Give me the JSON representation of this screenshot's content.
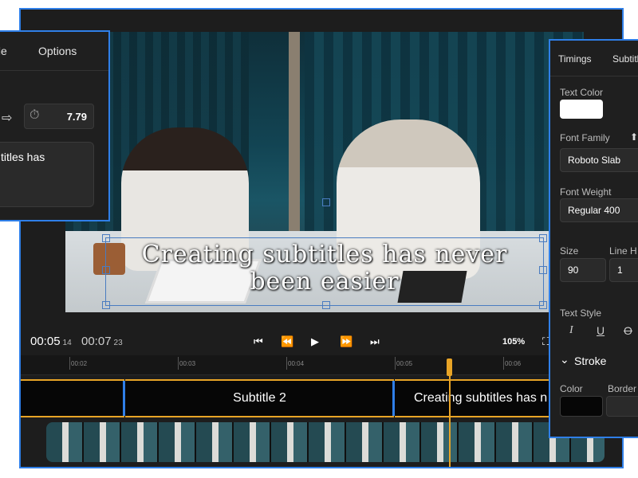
{
  "colors": {
    "accent": "#2f7fe8",
    "track": "#e8a426",
    "text_color_swatch": "#ffffff",
    "stroke_color_swatch": "#060606"
  },
  "video": {
    "caption_line1": "Creating subtitles has never",
    "caption_line2": "been easier"
  },
  "player": {
    "current_time": "00:05",
    "current_frames": "14",
    "total_time": "00:07",
    "total_frames": "23",
    "controls": {
      "skip_start": "⏮",
      "rewind": "⏪",
      "play": "▶",
      "forward": "⏩",
      "skip_end": "⏭"
    },
    "zoom": "105%",
    "fullscreen_icon": "⛶"
  },
  "timeline": {
    "ticks": [
      "00:02",
      "00:03",
      "00:04",
      "00:05",
      "00:06"
    ],
    "segments": [
      "Subtitle 2",
      "Creating subtitles has n"
    ]
  },
  "left_panel": {
    "tabs": [
      "tle",
      "Options"
    ],
    "arrow_icon": "⇨",
    "timer_icon": "⏱",
    "duration": "7.79",
    "text": "titles has"
  },
  "right_panel": {
    "tabs": [
      "Timings",
      "Subtitl"
    ],
    "text_color_label": "Text Color",
    "font_family_label": "Font Family",
    "upload_icon": "⬆",
    "font_family_value": "Roboto Slab",
    "font_weight_label": "Font Weight",
    "font_weight_value": "Regular 400",
    "size_label": "Size",
    "size_value": "90",
    "line_height_label": "Line H",
    "line_height_value": "1",
    "text_style_label": "Text Style",
    "style_italic": "I",
    "style_underline": "U",
    "style_strike": "O",
    "stroke_chevron": "⌄",
    "stroke_label": "Stroke",
    "color_label": "Color",
    "border_label": "Border"
  }
}
